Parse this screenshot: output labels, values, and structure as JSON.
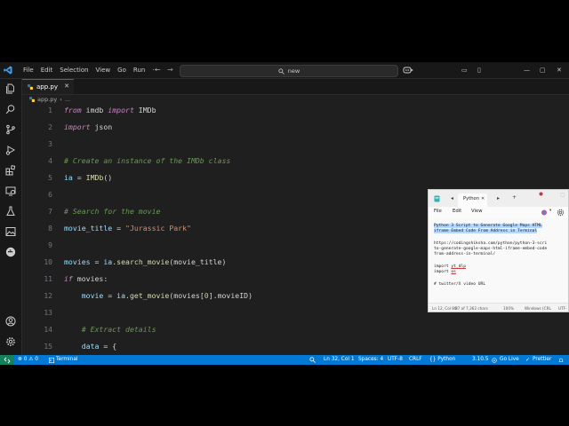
{
  "colors": {
    "accent": "#0078d4",
    "editor_bg": "#1f1f1f",
    "chrome_bg": "#181818",
    "python_blue": "#3572a5",
    "python_yellow": "#ffd43b"
  },
  "titlebar": {
    "menu": [
      "File",
      "Edit",
      "Selection",
      "View",
      "Go",
      "Run",
      "···"
    ],
    "nav_back": "←",
    "nav_forward": "→",
    "search_text": "new",
    "win_buttons": [
      "▭",
      "▯",
      "—",
      "▢",
      "✕"
    ]
  },
  "activity_icons": [
    "files-icon",
    "search-icon",
    "source-control-icon",
    "run-debug-icon",
    "extensions-icon",
    "remote-explorer-icon",
    "testing-icon",
    "image-icon",
    "docker-icon",
    "account-icon",
    "settings-gear-icon"
  ],
  "tab": {
    "label": "app.py",
    "close": "✕"
  },
  "breadcrumb": {
    "file": "app.py",
    "sep": "›",
    "rest": "..."
  },
  "editor_lines": [
    {
      "num": "1"
    },
    {
      "num": "2"
    },
    {
      "num": "3"
    },
    {
      "num": "4"
    },
    {
      "num": "5"
    },
    {
      "num": "6"
    },
    {
      "num": "7"
    },
    {
      "num": "8"
    },
    {
      "num": "9"
    },
    {
      "num": "10"
    },
    {
      "num": "11"
    },
    {
      "num": "12"
    },
    {
      "num": "13"
    },
    {
      "num": "14"
    },
    {
      "num": "15"
    }
  ],
  "code": {
    "l1_from": "from",
    "l1_mod": " imdb ",
    "l1_import": "import",
    "l1_name": " IMDb",
    "l2_import": "import",
    "l2_mod": " json",
    "l4_comment": "# Create an instance of the IMDb class",
    "l5_var": "ia",
    "l5_eq": " = ",
    "l5_fn": "IMDb",
    "l5_paren": "()",
    "l7_comment": "# Search for the movie",
    "l8_var": "movie_title",
    "l8_eq": " = ",
    "l8_str": "\"Jurassic Park\"",
    "l10_var": "movies",
    "l10_eq": " = ",
    "l10_obj": "ia",
    "l10_dot": ".",
    "l10_fn": "search_movie",
    "l10_args": "(movie_title)",
    "l11_if": "if",
    "l11_rest": " movies:",
    "l12_indent": "    ",
    "l12_var": "movie",
    "l12_eq": " = ",
    "l12_obj": "ia",
    "l12_dot": ".",
    "l12_fn": "get_movie",
    "l12_open": "(movies[",
    "l12_num": "0",
    "l12_close": "].movieID)",
    "l14_comment": "    # Extract details",
    "l15_var": "    data",
    "l15_rest": " = {"
  },
  "statusbar": {
    "errors": "⊗ 0 ⚠ 0",
    "terminal": "Terminal",
    "position": "Ln 32, Col 1",
    "spaces": "Spaces: 4",
    "encoding": "UTF-8",
    "eol": "CRLF",
    "language": "{} Python",
    "version": "3.10.5",
    "golive": "Go Live",
    "prettier": "Prettier"
  },
  "notepad": {
    "tab_label": "Python",
    "tab_close": "✕",
    "add_tab": "+",
    "menu": [
      "File",
      "Edit",
      "View"
    ],
    "line1a": "Python 3 Script to Generate Google Maps HTML",
    "line1b": "iframe Embed Code From Address in Terminal",
    "url1": "https://codingshiksha.com/python/python-3-scri",
    "url2": "to-generate-google-maps-html-iframe-embed-code",
    "url3": "from-address-in-terminal/",
    "imp1a": "import ",
    "imp1b": "yt_dlp",
    "imp2a": "import ",
    "imp2b": "os",
    "comment": "# twitter/X video URL",
    "status": {
      "pos": "Ln 12, Col 80",
      "chars": "87 of 7,362 chars",
      "zoom": "100%",
      "eol": "Windows (CRL",
      "enc": "UTF-"
    }
  }
}
